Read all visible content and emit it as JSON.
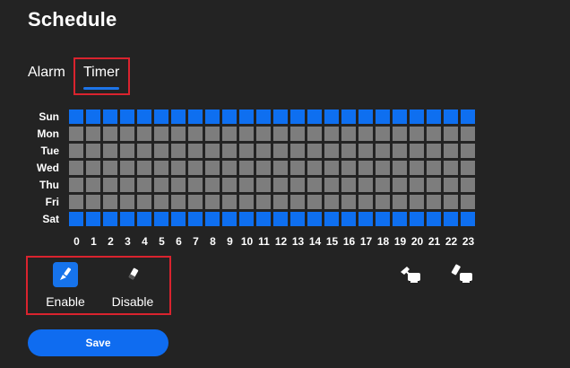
{
  "page": {
    "title": "Schedule"
  },
  "tabs": [
    {
      "label": "Alarm",
      "active": false
    },
    {
      "label": "Timer",
      "active": true
    }
  ],
  "schedule": {
    "days": [
      "Sun",
      "Mon",
      "Tue",
      "Wed",
      "Thu",
      "Fri",
      "Sat"
    ],
    "hours": [
      "0",
      "1",
      "2",
      "3",
      "4",
      "5",
      "6",
      "7",
      "8",
      "9",
      "10",
      "11",
      "12",
      "13",
      "14",
      "15",
      "16",
      "17",
      "18",
      "19",
      "20",
      "21",
      "22",
      "23"
    ],
    "enabled_days": [
      "Sun",
      "Sat"
    ],
    "colors": {
      "enabled": "#0e6ff0",
      "disabled": "#7d7d7d"
    }
  },
  "tools": {
    "enable": {
      "label": "Enable",
      "icon": "brush-icon",
      "selected": true
    },
    "disable": {
      "label": "Disable",
      "icon": "eraser-icon",
      "selected": false
    }
  },
  "right_tools": [
    {
      "icon": "paint-all-icon"
    },
    {
      "icon": "erase-all-icon"
    }
  ],
  "actions": {
    "save_label": "Save"
  },
  "colors": {
    "accent": "#0f6cf0",
    "highlight": "#d9232e",
    "background": "#232323"
  }
}
